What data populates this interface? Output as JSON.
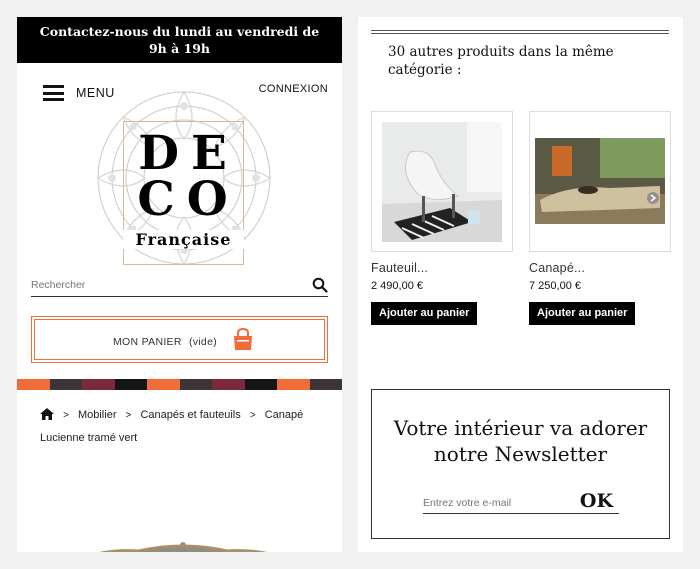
{
  "topbar": {
    "text": "Contactez-nous du lundi au vendredi de 9h à 19h"
  },
  "header": {
    "menu_label": "MENU",
    "login_label": "CONNEXION"
  },
  "logo": {
    "line1": "DE",
    "line2": "CO",
    "subtitle": "Française"
  },
  "search": {
    "placeholder": "Rechercher"
  },
  "cart": {
    "label": "MON PANIER",
    "status": "(vide)"
  },
  "stripe_colors": [
    "#f06d3a",
    "#3c3537",
    "#7b2a3b",
    "#151515",
    "#f06d3a",
    "#3c3537",
    "#7b2a3b",
    "#151515",
    "#f06d3a",
    "#3c3537"
  ],
  "breadcrumb": {
    "items": [
      "Mobilier",
      "Canapés et fauteuils"
    ],
    "current": "Canapé Lucienne tramé vert"
  },
  "related": {
    "title": "30 autres produits dans la même catégorie :",
    "products": [
      {
        "name": "Fauteuil...",
        "price": "2 490,00 €",
        "button": "Ajouter au panier"
      },
      {
        "name": "Canapé...",
        "price": "7 250,00 €",
        "button": "Ajouter au panier"
      }
    ]
  },
  "newsletter": {
    "title": "Votre intérieur va adorer notre Newsletter",
    "placeholder": "Entrez votre e-mail",
    "submit": "OK"
  },
  "colors": {
    "accent": "#f06d3a",
    "black": "#000000",
    "border": "#dddddd"
  }
}
